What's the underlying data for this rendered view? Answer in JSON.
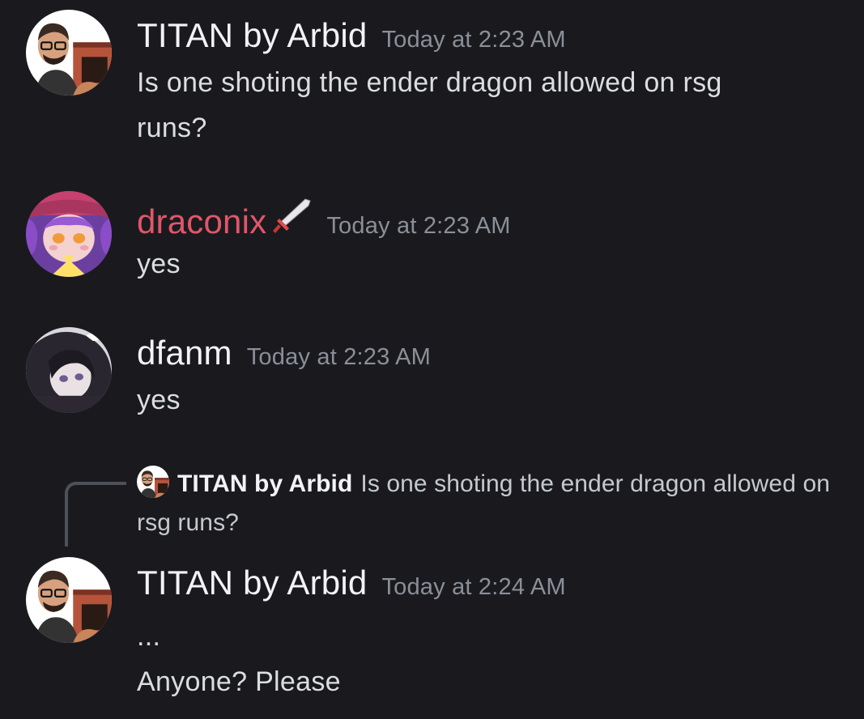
{
  "messages": [
    {
      "username": "TITAN by Arbid",
      "timestamp": "Today at 2:23 AM",
      "lines": [
        "Is one shoting the ender dragon allowed on rsg",
        "runs?"
      ]
    },
    {
      "username": "draconix",
      "timestamp": "Today at 2:23 AM",
      "name_color": "#e0566a",
      "badge_icon": "sword-icon",
      "lines": [
        "yes"
      ]
    },
    {
      "username": "dfanm",
      "timestamp": "Today at 2:23 AM",
      "lines": [
        "yes"
      ]
    },
    {
      "reply": {
        "username": "TITAN by Arbid",
        "text": "Is one shoting the ender dragon allowed on rsg runs?"
      },
      "username": "TITAN by Arbid",
      "timestamp": "Today at 2:24 AM",
      "lines": [
        "...",
        "Anyone? Please"
      ]
    }
  ],
  "colors": {
    "background": "#1a1a1e",
    "username": "#f2f3f5",
    "timestamp": "#8a8f98",
    "text": "#dbdee1"
  }
}
